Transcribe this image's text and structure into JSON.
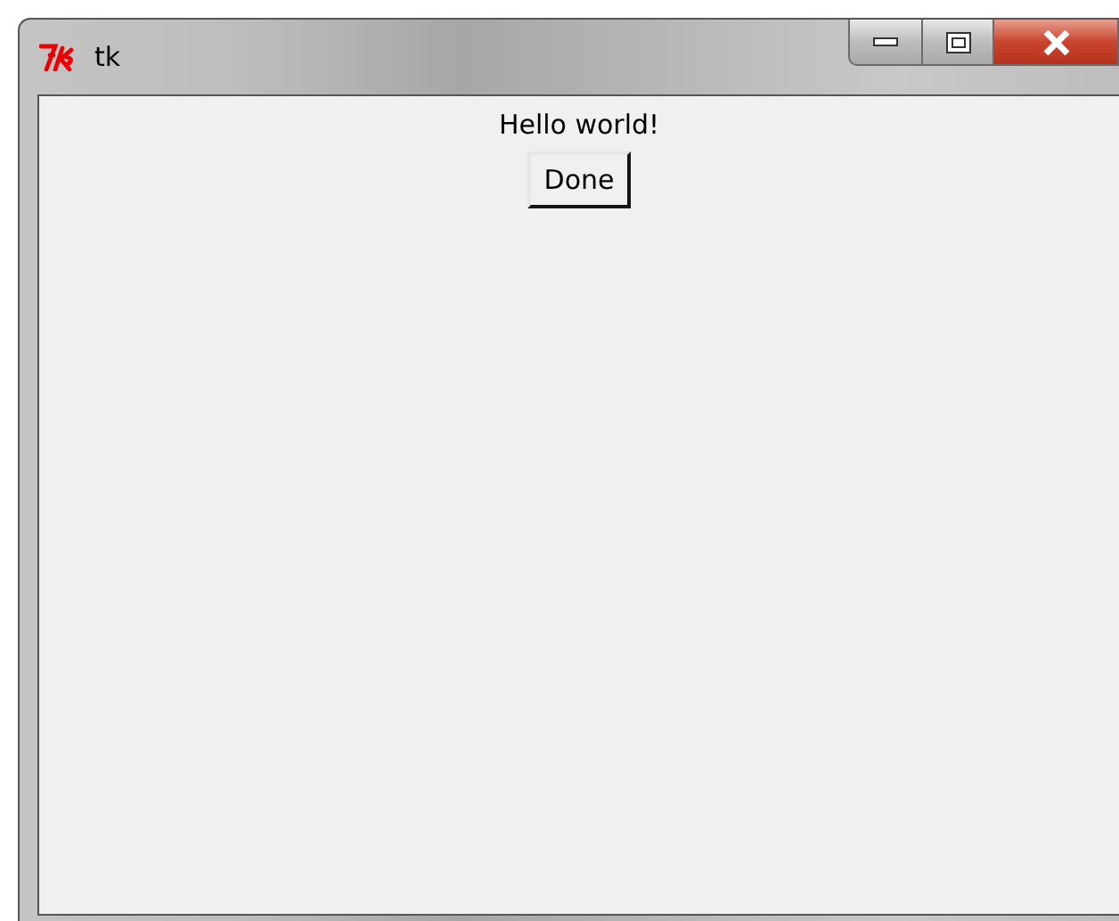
{
  "window": {
    "title": "tk"
  },
  "content": {
    "label": "Hello world!",
    "button": "Done"
  }
}
